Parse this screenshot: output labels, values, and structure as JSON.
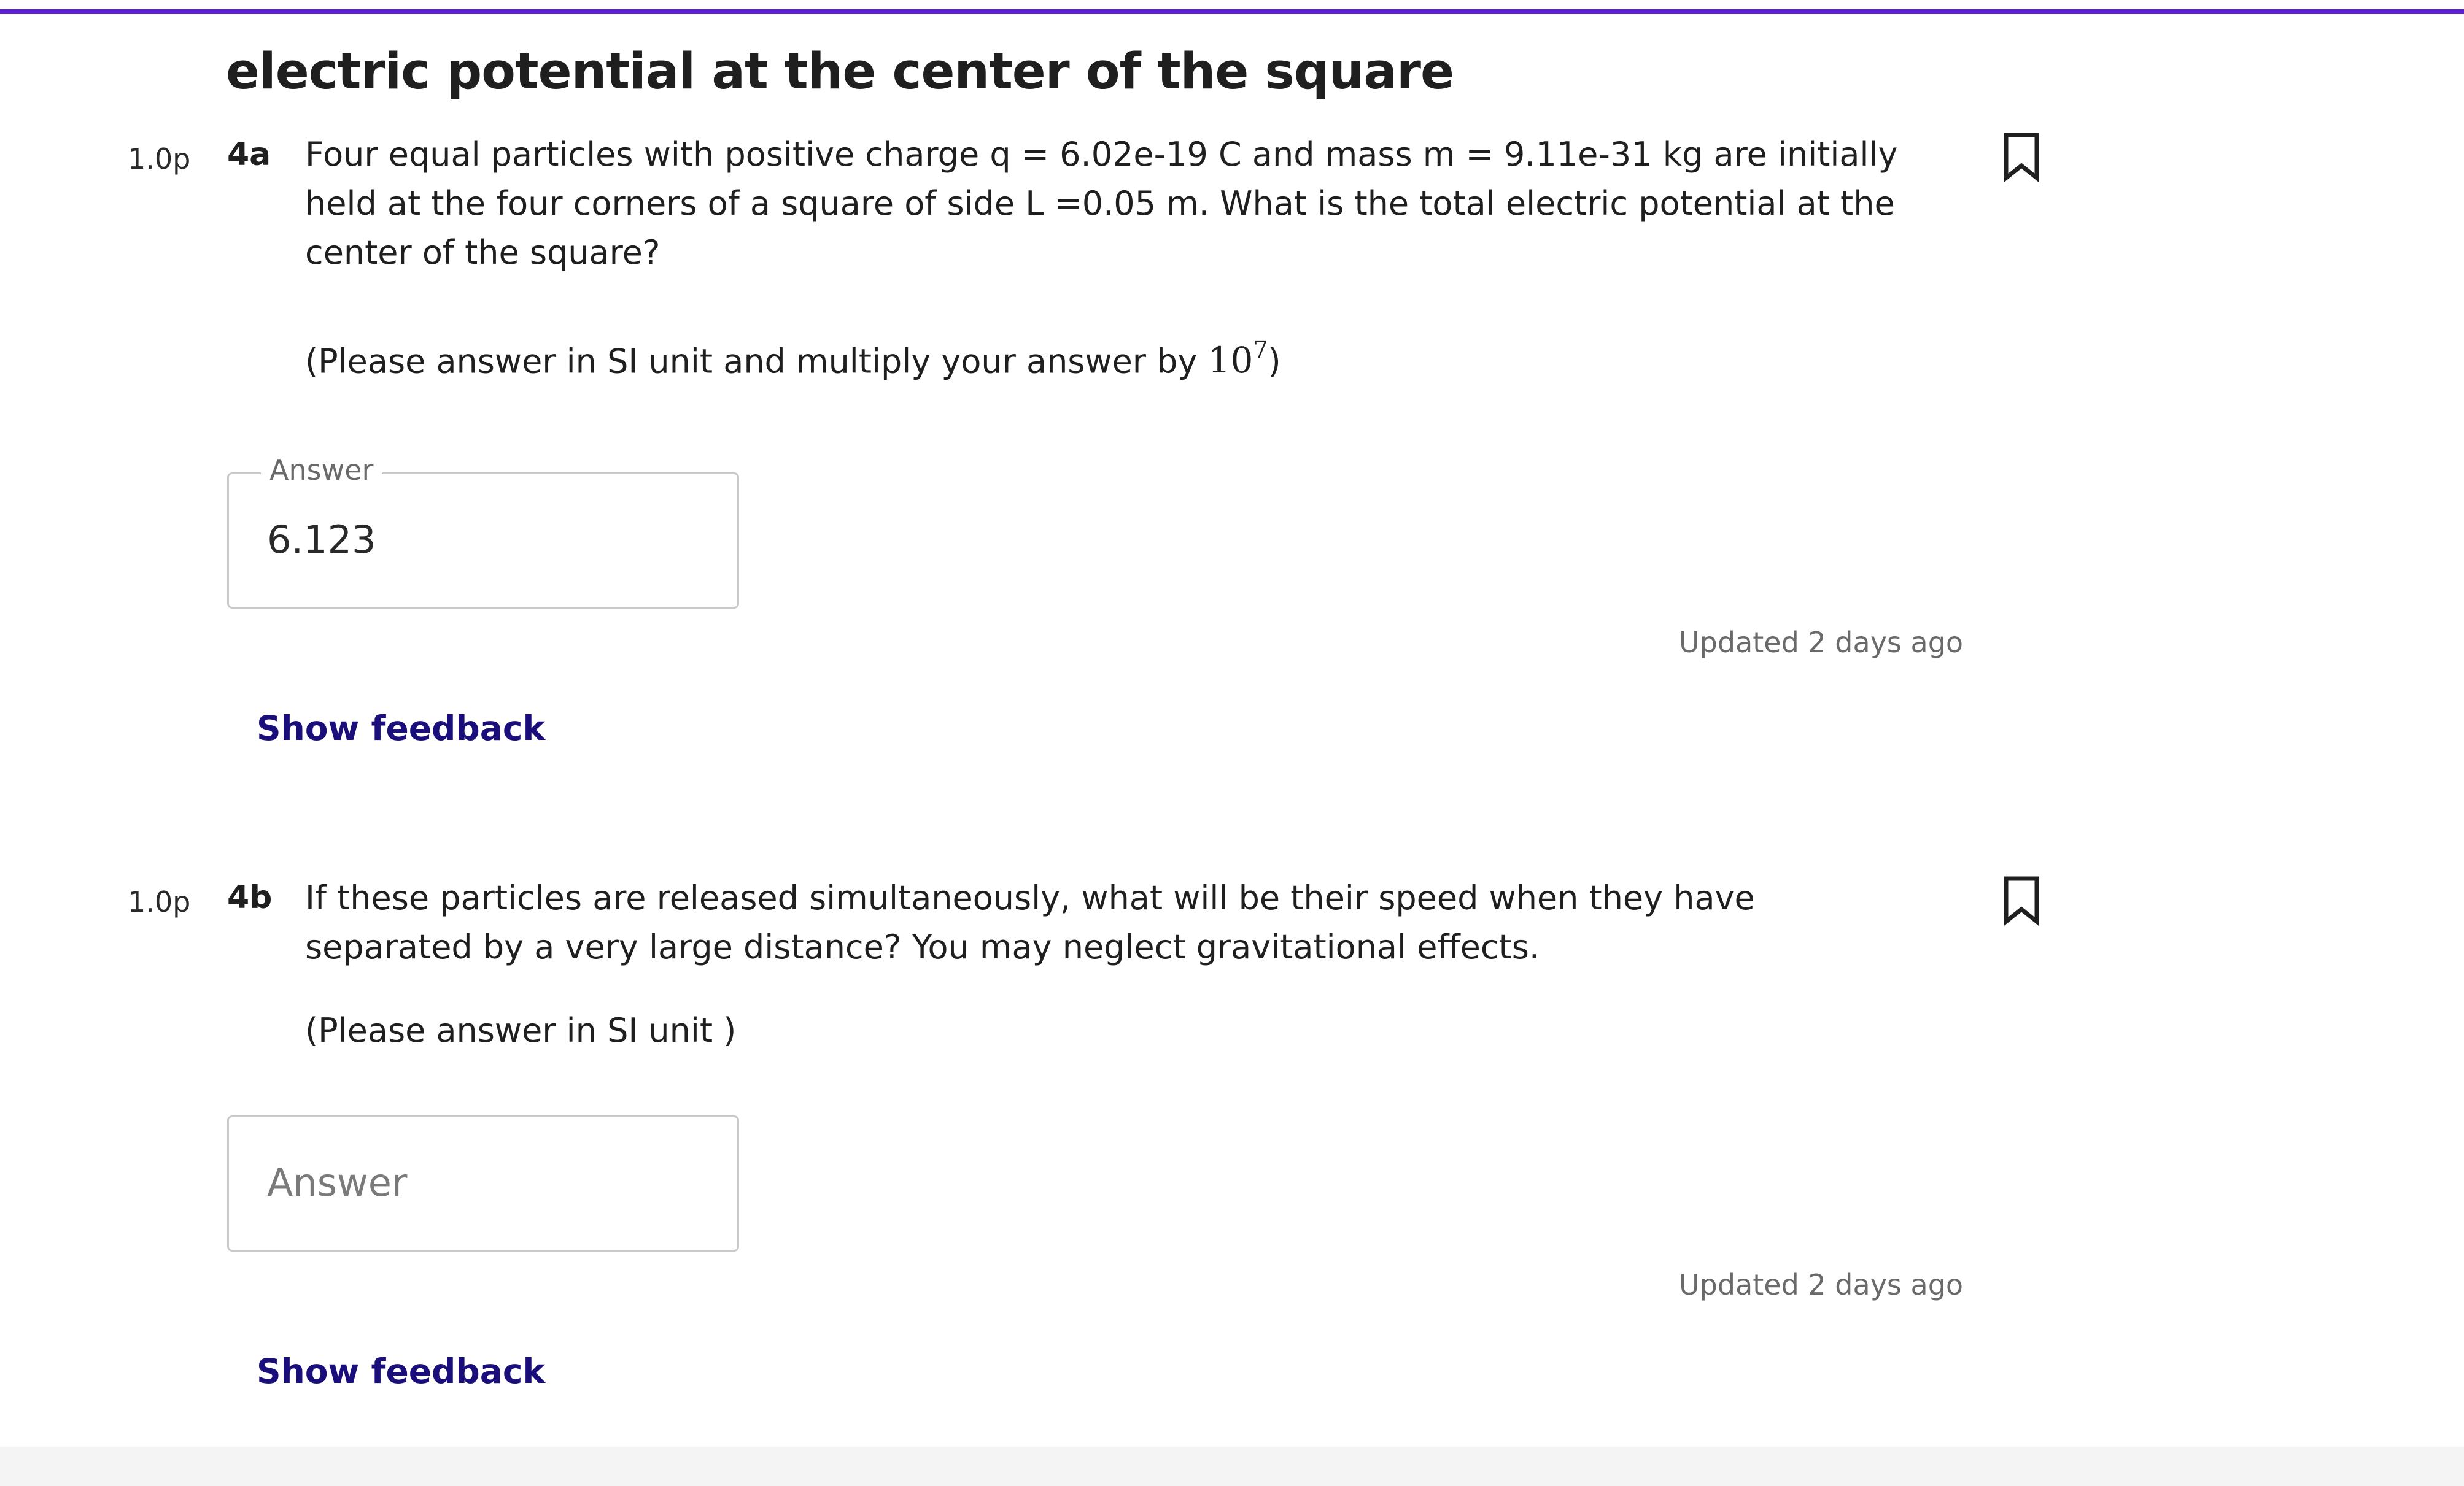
{
  "section": {
    "title": "electric potential at the center of the square"
  },
  "questions": [
    {
      "points": "1.0p",
      "number": "4a",
      "text": "Four equal particles with positive charge q =  6.02e-19 C and mass m = 9.11e-31 kg are initially held at the four corners of a square of side L =0.05 m. What is the total electric potential at the center of the square?",
      "note_prefix": "(Please answer in SI unit and multiply your answer by ",
      "note_base": "10",
      "note_exponent": "7",
      "note_suffix": ")",
      "answer_label": "Answer",
      "answer_value": "6.123",
      "updated": "Updated 2 days ago",
      "feedback_label": "Show feedback",
      "bookmark_icon": "bookmark-icon"
    },
    {
      "points": "1.0p",
      "number": "4b",
      "text": "If these particles are released simultaneously, what will be their speed when they have separated by a very large distance? You may neglect gravitational effects.",
      "note": "(Please answer in SI unit )",
      "answer_placeholder": "Answer",
      "answer_value": "",
      "updated": "Updated 2 days ago",
      "feedback_label": "Show feedback",
      "bookmark_icon": "bookmark-icon"
    }
  ],
  "colors": {
    "accent": "#5b1fd0",
    "link": "#1a0f7a",
    "muted_text": "#6a6a6a"
  }
}
